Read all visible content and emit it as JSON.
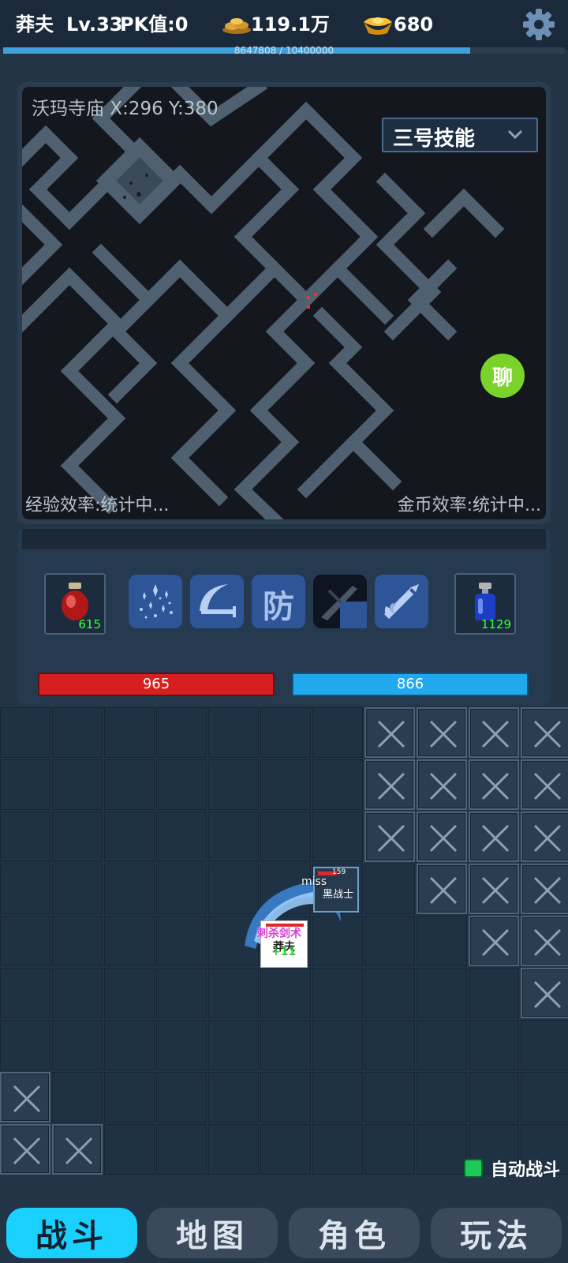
{
  "player": {
    "name": "莽夫",
    "level": "Lv.33",
    "pk": "PK值:0"
  },
  "currency": {
    "gold_icon": "gold-pile-icon",
    "gold": "119.1万",
    "ingot_icon": "gold-ingot-icon",
    "ingot": "680"
  },
  "exp": {
    "text": "8647808 / 10400000",
    "fraction": 0.831
  },
  "settings_icon": "gear-icon",
  "map": {
    "location": "沃玛寺庙 X:296 Y:380",
    "skill_select": "三号技能",
    "chat_button": "聊",
    "exp_efficiency": "经验效率:统计中...",
    "gold_efficiency": "金币效率:统计中..."
  },
  "potions": {
    "hp": {
      "icon": "red-potion-icon",
      "count": "615"
    },
    "mp": {
      "icon": "blue-potion-icon",
      "count": "1129"
    }
  },
  "skills": [
    {
      "icon": "sparkle-skill-icon"
    },
    {
      "icon": "crescent-slash-skill-icon"
    },
    {
      "icon": "defense-skill-icon",
      "label": "防"
    },
    {
      "icon": "dark-slash-skill-icon",
      "cooldown": 0.75
    },
    {
      "icon": "flaming-sword-skill-icon"
    }
  ],
  "hp": "965",
  "mp": "866",
  "battle": {
    "enemy_hp": "159",
    "enemy_name": "黑战士",
    "miss_text": "miss",
    "player_name": "莽夫",
    "skill_text": "刺杀剑术",
    "heal_text": "+11"
  },
  "auto_battle": {
    "label": "自动战斗",
    "checked": true
  },
  "nav": {
    "tabs": [
      "战斗",
      "地图",
      "角色",
      "玩法"
    ],
    "active": 0
  },
  "colors": {
    "accent": "#1ad0ff",
    "hp": "#d81f1f",
    "mp": "#22a8ec",
    "chat": "#7bd22b"
  }
}
